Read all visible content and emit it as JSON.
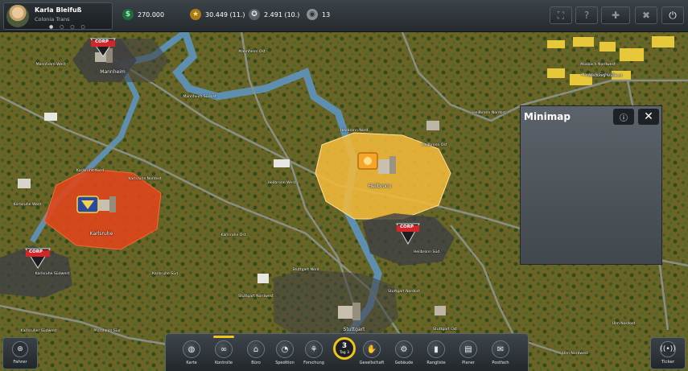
{
  "profile": {
    "name": "Karla Bleifuß",
    "company": "Colonia Trans",
    "page_dots": "● ○ ○ ○"
  },
  "stats": {
    "money": "270.000",
    "prestige": "30.449 (11.)",
    "rank_points": "2.491 (10.)",
    "reputation": "13"
  },
  "topbar_buttons": [
    {
      "name": "fullscreen-icon",
      "glyph": "⛶"
    },
    {
      "name": "help-icon",
      "glyph": "?"
    },
    {
      "name": "truck-add-icon",
      "glyph": "✚"
    },
    {
      "name": "tools-icon",
      "glyph": "✖"
    },
    {
      "name": "power-icon",
      "glyph": "⏻"
    }
  ],
  "colors": {
    "orange_region": "#e0461b",
    "yellow_region": "#f1b93a",
    "dark_region": "#3f4043",
    "accent": "#f0c419",
    "river": "#5f8fb0"
  },
  "cities": [
    {
      "name": "Mannheim West"
    },
    {
      "name": "Mannheim"
    },
    {
      "name": "Mannheim Ost"
    },
    {
      "name": "Mannheim Südost"
    },
    {
      "name": "Mosbach Nordwest"
    },
    {
      "name": "Mosbach Südwest"
    },
    {
      "name": "Karlsruhe Nord"
    },
    {
      "name": "Karlsruhe Nordost"
    },
    {
      "name": "Karlsruhe West"
    },
    {
      "name": "Karlsruhe"
    },
    {
      "name": "Karlsruhe Südwest"
    },
    {
      "name": "Karlsruhe Süd"
    },
    {
      "name": "Karlsruhe Ost"
    },
    {
      "name": "Heilbronn West"
    },
    {
      "name": "Heilbronn Nord"
    },
    {
      "name": "Heilbronn"
    },
    {
      "name": "Heilbronn Ost"
    },
    {
      "name": "Heilbronn Süd"
    },
    {
      "name": "Heilbronn Nordost"
    },
    {
      "name": "Stuttgart Nord"
    },
    {
      "name": "Stuttgart Nordwest"
    },
    {
      "name": "Stuttgart Nordost"
    },
    {
      "name": "Stuttgart"
    },
    {
      "name": "Stuttgart Ost"
    },
    {
      "name": "Würzburg Südwest"
    },
    {
      "name": "Ulm Nordwest"
    },
    {
      "name": "Ulm Nordost"
    },
    {
      "name": "Karlsruher Südwest"
    },
    {
      "name": "Pforzheim Süd"
    }
  ],
  "map_badges": {
    "corp": "CORP"
  },
  "minimap": {
    "title": "Minimap"
  },
  "bottom_nav": [
    {
      "label": "Karte",
      "icon": "globe-icon",
      "glyph": "◍"
    },
    {
      "label": "Kontrolle",
      "icon": "control-icon",
      "glyph": "∞"
    },
    {
      "label": "Büro",
      "icon": "office-icon",
      "glyph": "⌂"
    },
    {
      "label": "Spedition",
      "icon": "speedometer-icon",
      "glyph": "◔"
    },
    {
      "label": "Forschung",
      "icon": "research-icon",
      "glyph": "⚘"
    },
    {
      "label": "Gesellschaft",
      "icon": "handshake-icon",
      "glyph": "✋"
    },
    {
      "label": "Gebäude",
      "icon": "building-icon",
      "glyph": "⚙"
    },
    {
      "label": "Rangliste",
      "icon": "ranking-icon",
      "glyph": "▮"
    },
    {
      "label": "Planer",
      "icon": "planner-icon",
      "glyph": "▤"
    },
    {
      "label": "Postfach",
      "icon": "mail-icon",
      "glyph": "✉"
    }
  ],
  "day": {
    "number": "3",
    "label": "Tag 3"
  },
  "side_buttons": {
    "left": "Fahrer",
    "right": "Ticker"
  }
}
